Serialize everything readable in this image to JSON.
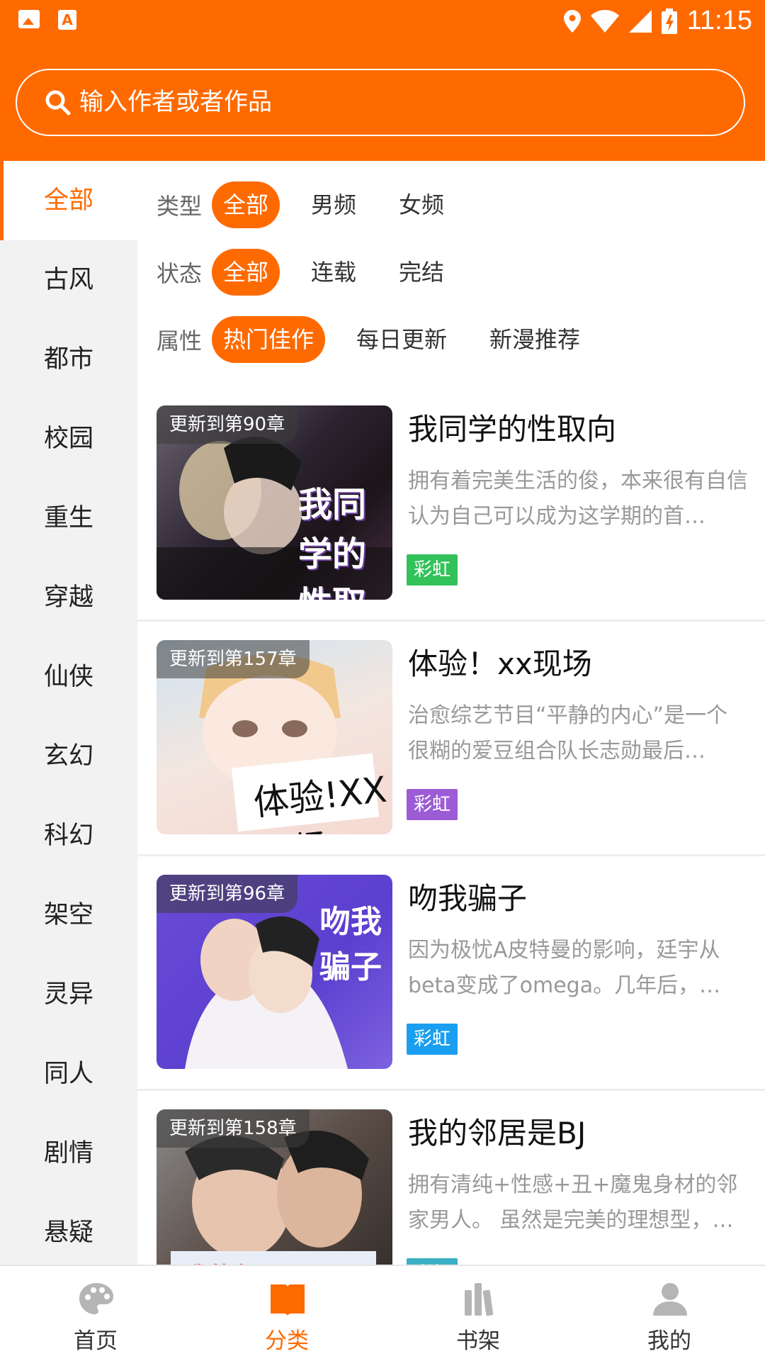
{
  "status_bar": {
    "time": "11:15"
  },
  "search": {
    "placeholder": "输入作者或者作品"
  },
  "colors": {
    "accent": "#ff6a00",
    "sidebar_bg": "#f2f2f2"
  },
  "sidebar": {
    "items": [
      {
        "label": "全部",
        "active": true
      },
      {
        "label": "古风"
      },
      {
        "label": "都市"
      },
      {
        "label": "校园"
      },
      {
        "label": "重生"
      },
      {
        "label": "穿越"
      },
      {
        "label": "仙侠"
      },
      {
        "label": "玄幻"
      },
      {
        "label": "科幻"
      },
      {
        "label": "架空"
      },
      {
        "label": "灵异"
      },
      {
        "label": "同人"
      },
      {
        "label": "剧情"
      },
      {
        "label": "悬疑"
      }
    ]
  },
  "filters": {
    "type": {
      "label": "类型",
      "options": [
        "全部",
        "男频",
        "女频"
      ],
      "selected": "全部"
    },
    "status": {
      "label": "状态",
      "options": [
        "全部",
        "连载",
        "完结"
      ],
      "selected": "全部"
    },
    "attribute": {
      "label": "属性",
      "options": [
        "热门佳作",
        "每日更新",
        "新漫推荐"
      ],
      "selected": "热门佳作"
    }
  },
  "comics": [
    {
      "title": "我同学的性取向",
      "chapter": "更新到第90章",
      "description": "拥有着完美生活的俊，本来很有自信认为自己可以成为这学期的首…",
      "tag": "彩虹",
      "tag_color": "#33c25a",
      "cover_title": "我同学的性取向"
    },
    {
      "title": "体验！xx现场",
      "chapter": "更新到第157章",
      "description": "治愈综艺节目“平静的内心”是一个很糊的爱豆组合队长志勋最后…",
      "tag": "彩虹",
      "tag_color": "#9b5cd6",
      "cover_title": "体验!XX现场"
    },
    {
      "title": "吻我骗子",
      "chapter": "更新到第96章",
      "description": "因为极忧A皮特曼的影响，廷宇从beta变成了omega。几年后，…",
      "tag": "彩虹",
      "tag_color": "#1a9ff0",
      "cover_title": "吻我骗子"
    },
    {
      "title": "我的邻居是BJ",
      "chapter": "更新到第158章",
      "description": "拥有清纯+性感+丑+魔鬼身材的邻家男人。 虽然是完美的理想型，…",
      "tag": "彩虹",
      "tag_color": "#3ab0c4",
      "cover_title": "我的邻居是BJ"
    }
  ],
  "bottom_nav": {
    "items": [
      {
        "label": "首页",
        "icon": "palette-icon"
      },
      {
        "label": "分类",
        "icon": "open-book-icon",
        "active": true
      },
      {
        "label": "书架",
        "icon": "bookshelf-icon"
      },
      {
        "label": "我的",
        "icon": "person-icon"
      }
    ]
  }
}
